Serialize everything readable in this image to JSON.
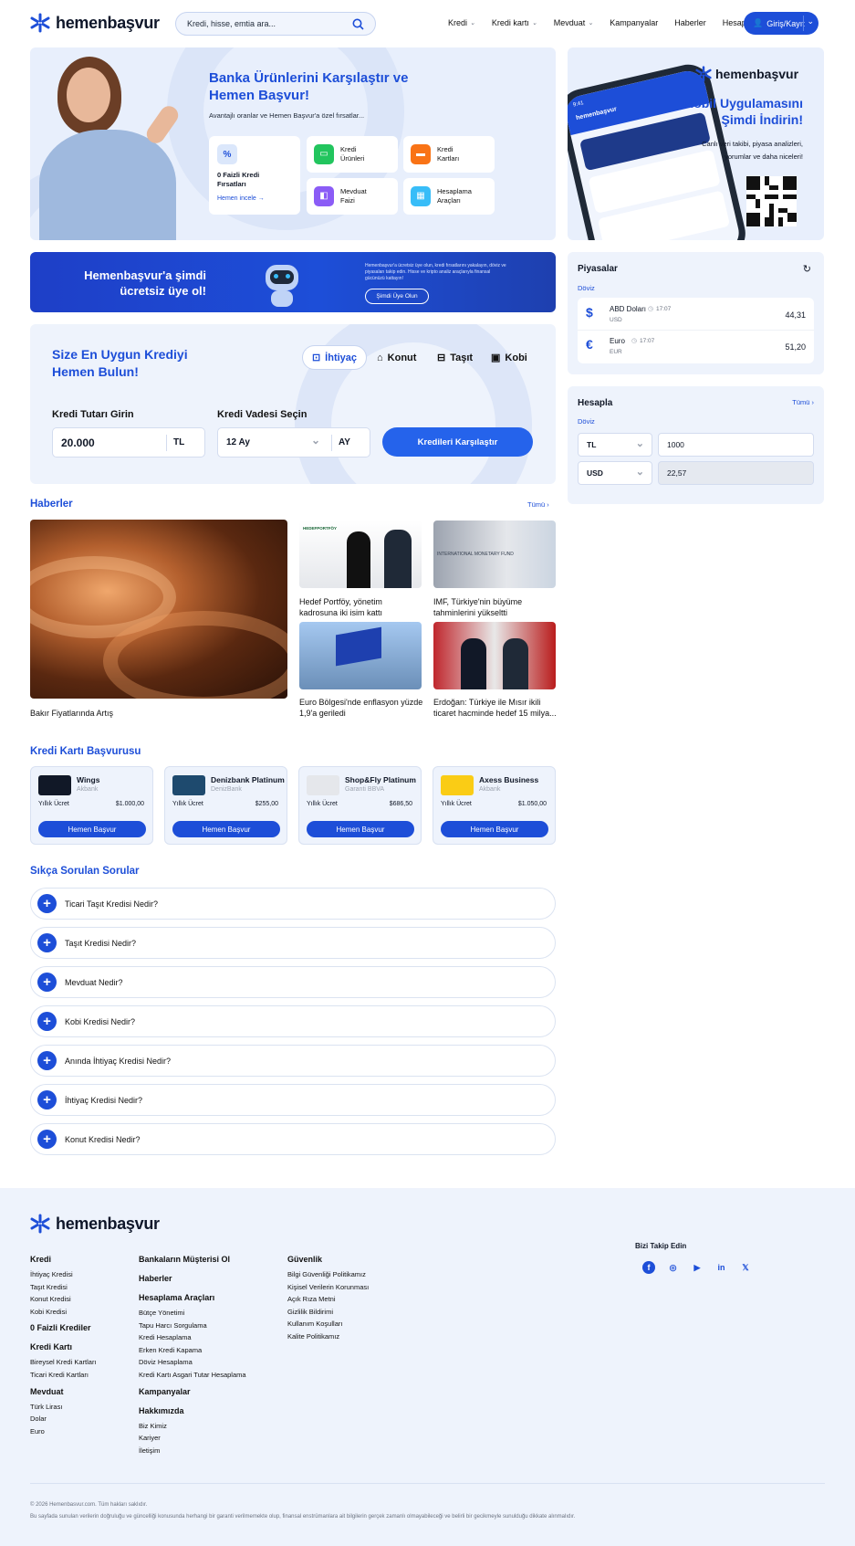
{
  "header": {
    "logo_text": "hemenbaşvur",
    "search_placeholder": "Kredi, hisse, emtia ara...",
    "nav": [
      "Kredi",
      "Kredi kartı",
      "Mevduat",
      "Kampanyalar",
      "Haberler",
      "Hesaplama"
    ],
    "nav_dropdown": [
      true,
      true,
      true,
      false,
      false,
      false
    ],
    "login_label": "Giriş/Kayıt"
  },
  "hero": {
    "title_line1": "Banka Ürünlerini Karşılaştır ve",
    "title_line2": "Hemen Başvur!",
    "subtitle": "Avantajlı oranlar ve Hemen Başvur'a özel fırsatlar...",
    "featured_title_line1": "0 Faizli Kredi",
    "featured_title_line2": "Fırsatları",
    "featured_link": "Hemen incele",
    "cards": [
      {
        "line1": "Kredi",
        "line2": "Ürünleri",
        "icon": "cash-icon",
        "color": "#22c55e"
      },
      {
        "line1": "Kredi",
        "line2": "Kartları",
        "icon": "credit-card-icon",
        "color": "#f97316"
      },
      {
        "line1": "Mevduat",
        "line2": "Faizi",
        "icon": "wallet-icon",
        "color": "#8b5cf6"
      },
      {
        "line1": "Hesaplama",
        "line2": "Araçları",
        "icon": "calculator-icon",
        "color": "#38bdf8"
      }
    ]
  },
  "app_promo": {
    "logo_text": "hemenbaşvur",
    "title_line1": "Mobil Uygulamasını",
    "title_line2": "Şimdi İndirin!",
    "desc_line1": "Canlı veri takibi, piyasa analizleri,",
    "desc_line2": "yorumlar ve daha niceleri!",
    "phone_time": "9:41",
    "phone_brand": "hemenbaşvur"
  },
  "member_banner": {
    "title_line1": "Hemenbaşvur'a şimdi",
    "title_line2": "ücretsiz üye ol!",
    "desc": "Hemenbaşvur'a ücretsiz üye olun, kredi fırsatlarını yakalayın, döviz ve piyasaları takip edin. Hisse ve kripto analiz araçlarıyla finansal gücünüzü kattayın!",
    "button": "Şimdi Üye Olun"
  },
  "credit_finder": {
    "title_line1": "Size En Uygun Krediyi",
    "title_line2": "Hemen Bulun!",
    "tabs": [
      "İhtiyaç",
      "Konut",
      "Taşıt",
      "Kobi"
    ],
    "active_tab": "İhtiyaç",
    "amount_label": "Kredi Tutarı Girin",
    "amount_value": "20.000",
    "amount_unit": "TL",
    "term_label": "Kredi Vadesi Seçin",
    "term_value": "12 Ay",
    "term_unit": "AY",
    "submit": "Kredileri Karşılaştır"
  },
  "markets": {
    "title": "Piyasalar",
    "subtitle": "Döviz",
    "items": [
      {
        "symbol": "$",
        "name": "ABD Doları",
        "time": "17:07",
        "code": "USD",
        "value": "44,31"
      },
      {
        "symbol": "€",
        "name": "Euro",
        "time": "17:07",
        "code": "EUR",
        "value": "51,20"
      }
    ]
  },
  "calculator": {
    "title": "Hesapla",
    "all_link": "Tümü",
    "subtitle": "Döviz",
    "from_currency": "TL",
    "from_amount": "1000",
    "to_currency": "USD",
    "to_amount": "22,57"
  },
  "news": {
    "title": "Haberler",
    "all_link": "Tümü",
    "main_caption": "Bakır Fiyatlarında Artış",
    "items": [
      {
        "line1": "Hedef Portföy, yönetim",
        "line2": "kadrosuna iki isim kattı"
      },
      {
        "line1": "IMF, Türkiye'nin büyüme",
        "line2": "tahminlerini yükseltti"
      },
      {
        "line1": "Euro Bölgesi'nde enflasyon yüzde",
        "line2": "1,9'a geriledi"
      },
      {
        "line1": "Erdoğan: Türkiye ile Mısır ikili",
        "line2": "ticaret hacminde hedef 15 milya..."
      }
    ],
    "img_text_1": "HEDEFPORTFÖY",
    "img_text_2": "INTERNATIONAL MONETARY FUND"
  },
  "credit_cards": {
    "title": "Kredi Kartı Başvurusu",
    "fee_label": "Yıllık Ücret",
    "button": "Hemen Başvur",
    "items": [
      {
        "name": "Wings",
        "bank": "Akbank",
        "fee": "$1.000,00",
        "color": "#111827"
      },
      {
        "name": "Denizbank Platinum",
        "bank": "DenizBank",
        "fee": "$255,00",
        "color": "#1e4a6e"
      },
      {
        "name": "Shop&Fly Platinum",
        "bank": "Garanti BBVA",
        "fee": "$686,50",
        "color": "#e5e7eb"
      },
      {
        "name": "Axess Business",
        "bank": "Akbank",
        "fee": "$1.050,00",
        "color": "#facc15"
      }
    ]
  },
  "faq": {
    "title": "Sıkça Sorulan Sorular",
    "items": [
      "Ticari Taşıt Kredisi Nedir?",
      "Taşıt Kredisi Nedir?",
      "Mevduat Nedir?",
      "Kobi Kredisi Nedir?",
      "Anında İhtiyaç Kredisi Nedir?",
      "İhtiyaç Kredisi Nedir?",
      "Konut Kredisi Nedir?"
    ]
  },
  "footer": {
    "logo_text": "hemenbaşvur",
    "col1": [
      {
        "heading": "Kredi",
        "links": [
          "İhtiyaç Kredisi",
          "Taşıt Kredisi",
          "Konut Kredisi",
          "Kobi Kredisi"
        ]
      },
      {
        "heading": "0 Faizli Krediler",
        "links": []
      },
      {
        "heading": "Kredi Kartı",
        "links": [
          "Bireysel Kredi Kartları",
          "Ticari Kredi Kartları"
        ]
      },
      {
        "heading": "Mevduat",
        "links": [
          "Türk Lirası",
          "Dolar",
          "Euro"
        ]
      }
    ],
    "col2": [
      {
        "heading": "Bankaların Müşterisi Ol",
        "links": []
      },
      {
        "heading": "Haberler",
        "links": []
      },
      {
        "heading": "Hesaplama Araçları",
        "links": [
          "Bütçe Yönetimi",
          "Tapu Harcı Sorgulama",
          "Kredi Hesaplama",
          "Erken Kredi Kapama",
          "Döviz Hesaplama",
          "Kredi Kartı Asgari Tutar Hesaplama"
        ]
      },
      {
        "heading": "Kampanyalar",
        "links": []
      },
      {
        "heading": "Hakkımızda",
        "links": [
          "Biz Kimiz",
          "Kariyer",
          "İletişim"
        ]
      }
    ],
    "col3": [
      {
        "heading": "Güvenlik",
        "links": [
          "Bilgi Güvenliği Politikamız",
          "Kişisel Verilerin Korunması",
          "Açık Rıza Metni",
          "Gizlilik Bildirimi",
          "Kullanım Koşulları",
          "Kalite Politikamız"
        ]
      }
    ],
    "follow_title": "Bizi Takip Edin",
    "socials": [
      "facebook-icon",
      "instagram-icon",
      "youtube-icon",
      "linkedin-icon",
      "x-icon"
    ],
    "social_glyphs": [
      "f",
      "◎",
      "▶",
      "in",
      "𝕏"
    ],
    "copyright": "© 2026 Hemenbasvur.com. Tüm hakları saklıdır.",
    "disclaimer": "Bu sayfada sunulan verilerin doğruluğu ve güncelliği konusunda herhangi bir garanti verilmemekte olup, finansal enstrümanlara ait bilgilerin gerçek zamanlı olmayabileceği ve belirli bir gecikmeyle sunulduğu dikkate alınmalıdır."
  },
  "colors": {
    "primary": "#1d4ed8",
    "soft_bg": "#eef3fc",
    "dark_text": "#111827"
  }
}
